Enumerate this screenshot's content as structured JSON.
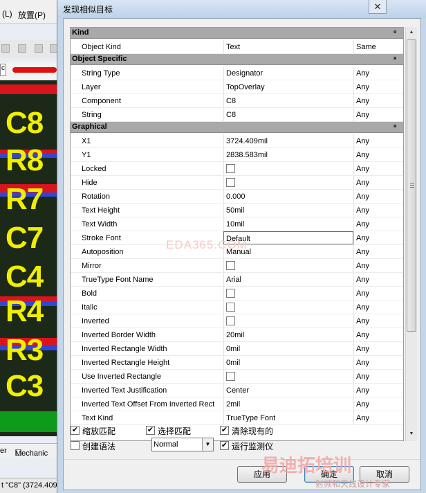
{
  "background_app": {
    "menu": [
      "(L)",
      "放置(P)"
    ],
    "filter_box_text": "c",
    "pcb_labels": [
      "C8",
      "R8",
      "R7",
      "C7",
      "C4",
      "R4",
      "R3",
      "C3"
    ],
    "tabs": [
      "er",
      "Mechanic"
    ],
    "status_text": "t \"C8\" (3724.409"
  },
  "dialog": {
    "title": "发现相似目标",
    "close_label": "✕",
    "categories": {
      "kind": "Kind",
      "object_specific": "Object Specific",
      "graphical": "Graphical"
    },
    "kind_rows": [
      {
        "name": "Object Kind",
        "value": "Text",
        "match": "Same"
      }
    ],
    "object_specific_rows": [
      {
        "name": "String Type",
        "value": "Designator",
        "match": "Any"
      },
      {
        "name": "Layer",
        "value": "TopOverlay",
        "match": "Any"
      },
      {
        "name": "Component",
        "value": "C8",
        "match": "Any"
      },
      {
        "name": "String",
        "value": "C8",
        "match": "Any"
      }
    ],
    "graphical_rows": [
      {
        "name": "X1",
        "value": "3724.409mil",
        "match": "Any"
      },
      {
        "name": "Y1",
        "value": "2838.583mil",
        "match": "Any"
      },
      {
        "name": "Locked",
        "value": "",
        "checkbox": true,
        "match": "Any"
      },
      {
        "name": "Hide",
        "value": "",
        "checkbox": true,
        "match": "Any"
      },
      {
        "name": "Rotation",
        "value": "0.000",
        "match": "Any"
      },
      {
        "name": "Text Height",
        "value": "50mil",
        "match": "Any"
      },
      {
        "name": "Text Width",
        "value": "10mil",
        "match": "Any"
      },
      {
        "name": "Stroke Font",
        "value": "Default",
        "match": "Any",
        "selected": true
      },
      {
        "name": "Autoposition",
        "value": "Manual",
        "match": "Any"
      },
      {
        "name": "Mirror",
        "value": "",
        "checkbox": true,
        "match": "Any"
      },
      {
        "name": "TrueType Font Name",
        "value": "Arial",
        "match": "Any"
      },
      {
        "name": "Bold",
        "value": "",
        "checkbox": true,
        "match": "Any"
      },
      {
        "name": "Italic",
        "value": "",
        "checkbox": true,
        "match": "Any"
      },
      {
        "name": "Inverted",
        "value": "",
        "checkbox": true,
        "match": "Any"
      },
      {
        "name": "Inverted Border Width",
        "value": "20mil",
        "match": "Any"
      },
      {
        "name": "Inverted Rectangle Width",
        "value": "0mil",
        "match": "Any"
      },
      {
        "name": "Inverted Rectangle Height",
        "value": "0mil",
        "match": "Any"
      },
      {
        "name": "Use Inverted Rectangle",
        "value": "",
        "checkbox": true,
        "match": "Any"
      },
      {
        "name": "Inverted Text Justification",
        "value": "Center",
        "match": "Any"
      },
      {
        "name": "Inverted Text Offset From Inverted Rect",
        "value": "2mil",
        "match": "Any"
      },
      {
        "name": "Text Kind",
        "value": "TrueType Font",
        "match": "Any"
      }
    ],
    "options": {
      "zoom_match": "缩放匹配",
      "select_match": "选择匹配",
      "clear_existing": "清除现有的",
      "create_expression": "创建语法",
      "run_inspector": "运行监测仪",
      "mode_value": "Normal"
    },
    "option_states": {
      "zoom_match": true,
      "select_match": true,
      "clear_existing": true,
      "create_expression": false,
      "run_inspector": true
    },
    "buttons": {
      "apply": "应用",
      "ok": "确定",
      "cancel": "取消"
    }
  },
  "watermarks": {
    "center": "EDA365.COM",
    "brand": "易迪拓培训",
    "tagline": "射频和天线设计专家"
  },
  "colors": {
    "pcb_label": "#f1ef00",
    "pcb_red": "#d8141c",
    "pcb_blue": "#2f46d6",
    "pcb_green": "#0e9a1a"
  }
}
